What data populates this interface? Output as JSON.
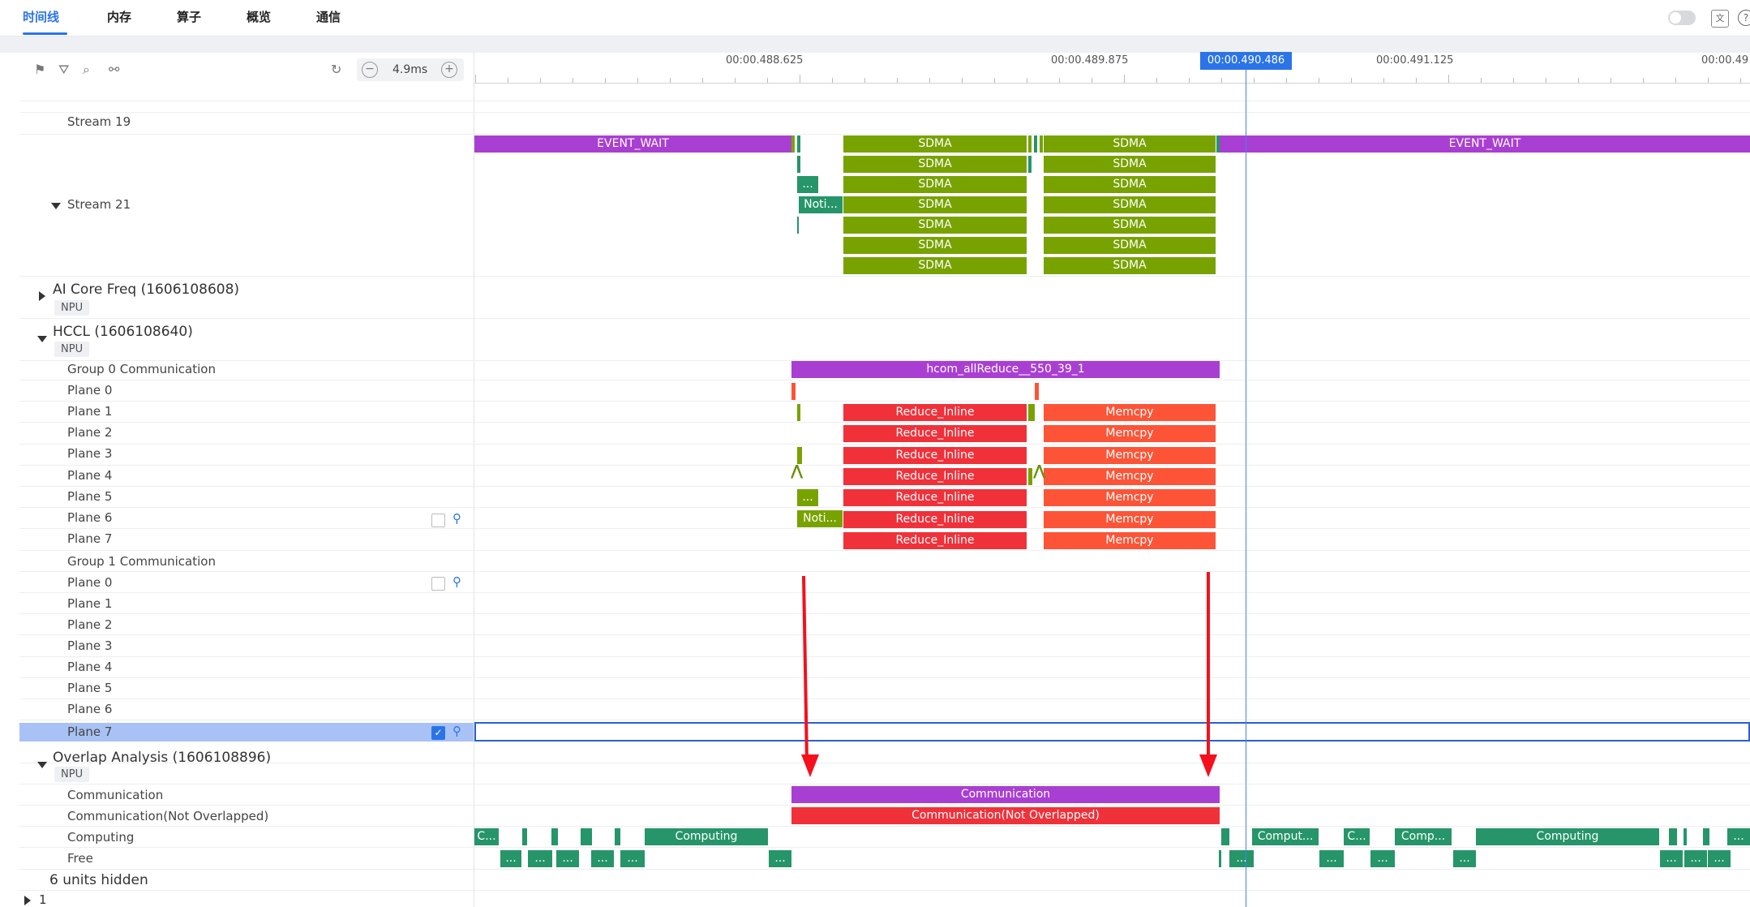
{
  "tabs": [
    "时间线",
    "内存",
    "算子",
    "概览",
    "通信"
  ],
  "toolbar": {
    "zoom": "4.9ms"
  },
  "ruler": {
    "labels": [
      "00:00.488.625",
      "00:00.489.875",
      "00:00.491.125",
      "00:00.49"
    ],
    "cursor": "00:00.490.486"
  },
  "rows": {
    "stream19": "Stream 19",
    "stream21": "Stream 21",
    "aicore": "AI Core Freq (1606108608)",
    "hccl": "HCCL (1606108640)",
    "npu": "NPU",
    "group0": "Group 0 Communication",
    "group1": "Group 1 Communication",
    "planes": [
      "Plane 0",
      "Plane 1",
      "Plane 2",
      "Plane 3",
      "Plane 4",
      "Plane 5",
      "Plane 6",
      "Plane 7"
    ],
    "overlap": "Overlap Analysis (1606108896)",
    "communication": "Communication",
    "comm_not_overlapped": "Communication(Not Overlapped)",
    "computing": "Computing",
    "free": "Free",
    "hidden": "6 units hidden",
    "next_group": "1"
  },
  "bars": {
    "event_wait": "EVENT_WAIT",
    "sdma": "SDMA",
    "ellipsis": "...",
    "noti": "Noti...",
    "hcom": "hcom_allReduce__550_39_1",
    "reduce": "Reduce_Inline",
    "memcpy": "Memcpy",
    "communication": "Communication",
    "comm_not_overlapped": "Communication(Not Overlapped)",
    "computing": "Computing",
    "c_short": "C...",
    "comput_short": "Comput...",
    "comp_short": "Comp..."
  },
  "colors": {
    "accent": "#2b74e8",
    "event_wait": "#a93fd2",
    "sdma": "#78a200",
    "teal": "#26956a",
    "reduce": "#f0313a",
    "memcpy": "#fd5437",
    "annotation_arrow": "#f4101c"
  }
}
